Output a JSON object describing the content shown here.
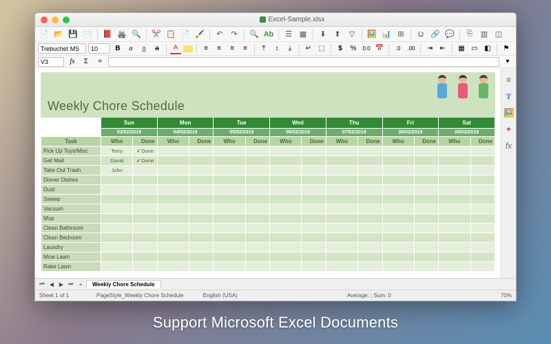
{
  "window": {
    "title": "Excel-Sample.xlsx"
  },
  "toolbar": {
    "font": "Trebuchet MS",
    "size": "10",
    "name_box": "V3",
    "formula": ""
  },
  "sheet": {
    "title": "Weekly Chore Schedule",
    "days": [
      {
        "name": "Sun",
        "date": "03/02/2019"
      },
      {
        "name": "Mon",
        "date": "04/02/2019"
      },
      {
        "name": "Tue",
        "date": "05/02/2019"
      },
      {
        "name": "Wed",
        "date": "06/02/2019"
      },
      {
        "name": "Thu",
        "date": "07/02/2019"
      },
      {
        "name": "Fri",
        "date": "08/02/2019"
      },
      {
        "name": "Sat",
        "date": "09/02/2019"
      }
    ],
    "subhead": {
      "task": "Task",
      "who": "Who",
      "done": "Done"
    },
    "rows": [
      {
        "task": "Pick Up Toys/Misc",
        "who": "Terry",
        "done": "Done",
        "check": true
      },
      {
        "task": "Get Mail",
        "who": "David",
        "done": "Done",
        "check": true
      },
      {
        "task": "Take Out Trash",
        "who": "John",
        "done": ""
      },
      {
        "task": "Dinner Dishes"
      },
      {
        "task": "Dust"
      },
      {
        "task": "Sweep"
      },
      {
        "task": "Vacuum"
      },
      {
        "task": "Mop"
      },
      {
        "task": "Clean Bathroom"
      },
      {
        "task": "Clean Bedroom"
      },
      {
        "task": "Laundry"
      },
      {
        "task": "Mow Lawn"
      },
      {
        "task": "Rake Lawn"
      }
    ]
  },
  "tabs": {
    "active": "Weekly Chore Schedule"
  },
  "status": {
    "sheet_count": "Sheet 1 of 1",
    "page_style": "PageStyle_Weekly Chore Schedule",
    "language": "English (USA)",
    "summary": "Average: ; Sum: 0",
    "zoom": "70%"
  },
  "caption": "Support Microsoft Excel Documents"
}
